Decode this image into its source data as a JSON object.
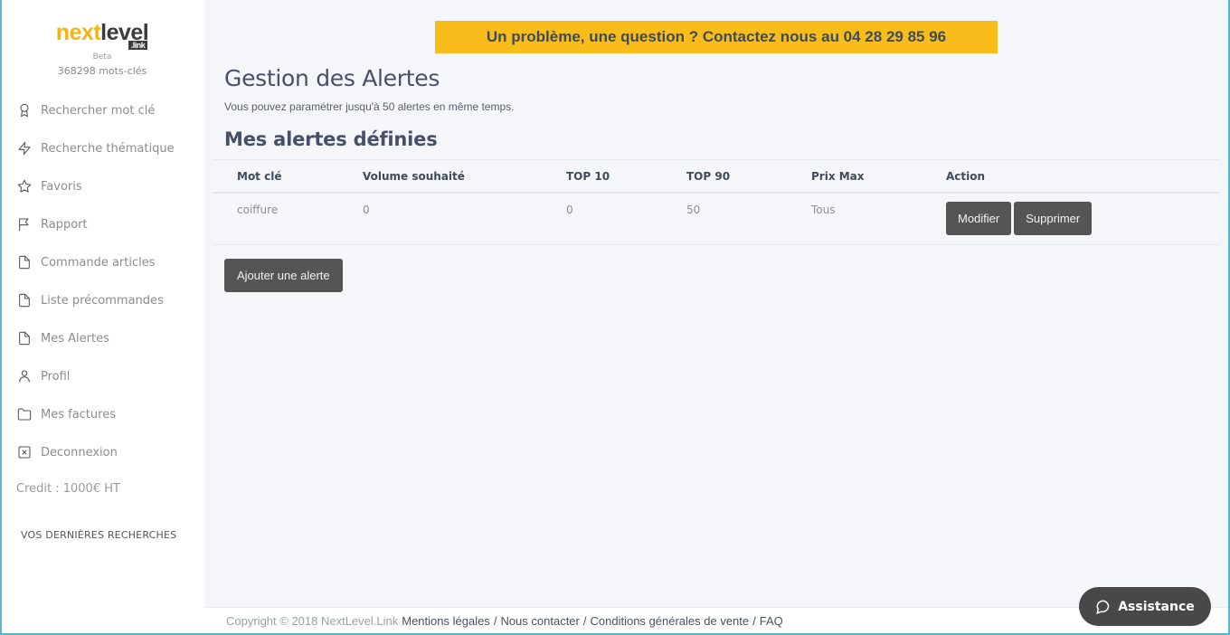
{
  "sidebar": {
    "logo": {
      "part1": "next",
      "part2": "level",
      "suffix": ".link"
    },
    "beta_label": "Beta",
    "keyword_count": "368298 mots-clés",
    "items": [
      {
        "label": "Rechercher mot clé",
        "icon": "award-icon"
      },
      {
        "label": "Recherche thématique",
        "icon": "lightning-icon"
      },
      {
        "label": "Favoris",
        "icon": "star-icon"
      },
      {
        "label": "Rapport",
        "icon": "flag-icon"
      },
      {
        "label": "Commande articles",
        "icon": "file-icon"
      },
      {
        "label": "Liste précommandes",
        "icon": "file-icon"
      },
      {
        "label": "Mes Alertes",
        "icon": "file-icon"
      },
      {
        "label": "Profil",
        "icon": "user-icon"
      },
      {
        "label": "Mes factures",
        "icon": "folder-icon"
      },
      {
        "label": "Deconnexion",
        "icon": "close-box-icon"
      }
    ],
    "credit": "Credit : 1000€ HT",
    "recent_searches_title": "VOS DERNIÈRES RECHERCHES"
  },
  "banner": {
    "text": "Un problème, une question ? Contactez nous au 04 28 29 85 96"
  },
  "main": {
    "title": "Gestion des Alertes",
    "subtitle": "Vous pouvez paramétrer jusqu'à 50 alertes en même temps.",
    "section_title": "Mes alertes définies",
    "table": {
      "headers": [
        "Mot clé",
        "Volume souhaité",
        "TOP 10",
        "TOP 90",
        "Prix Max",
        "Action"
      ],
      "rows": [
        {
          "keyword": "coiffure",
          "volume": "0",
          "top10": "0",
          "top90": "50",
          "max_price": "Tous",
          "edit_label": "Modifier",
          "delete_label": "Supprimer"
        }
      ]
    },
    "add_button": "Ajouter une alerte"
  },
  "footer": {
    "copyright": "Copyright © 2018 NextLevel.Link",
    "links": [
      "Mentions légales",
      "Nous contacter",
      "Conditions générales de vente",
      "FAQ"
    ]
  },
  "assistance": {
    "label": "Assistance"
  },
  "colors": {
    "accent": "#f8bd1a",
    "button": "#555555",
    "frame": "#5bb4c9"
  }
}
